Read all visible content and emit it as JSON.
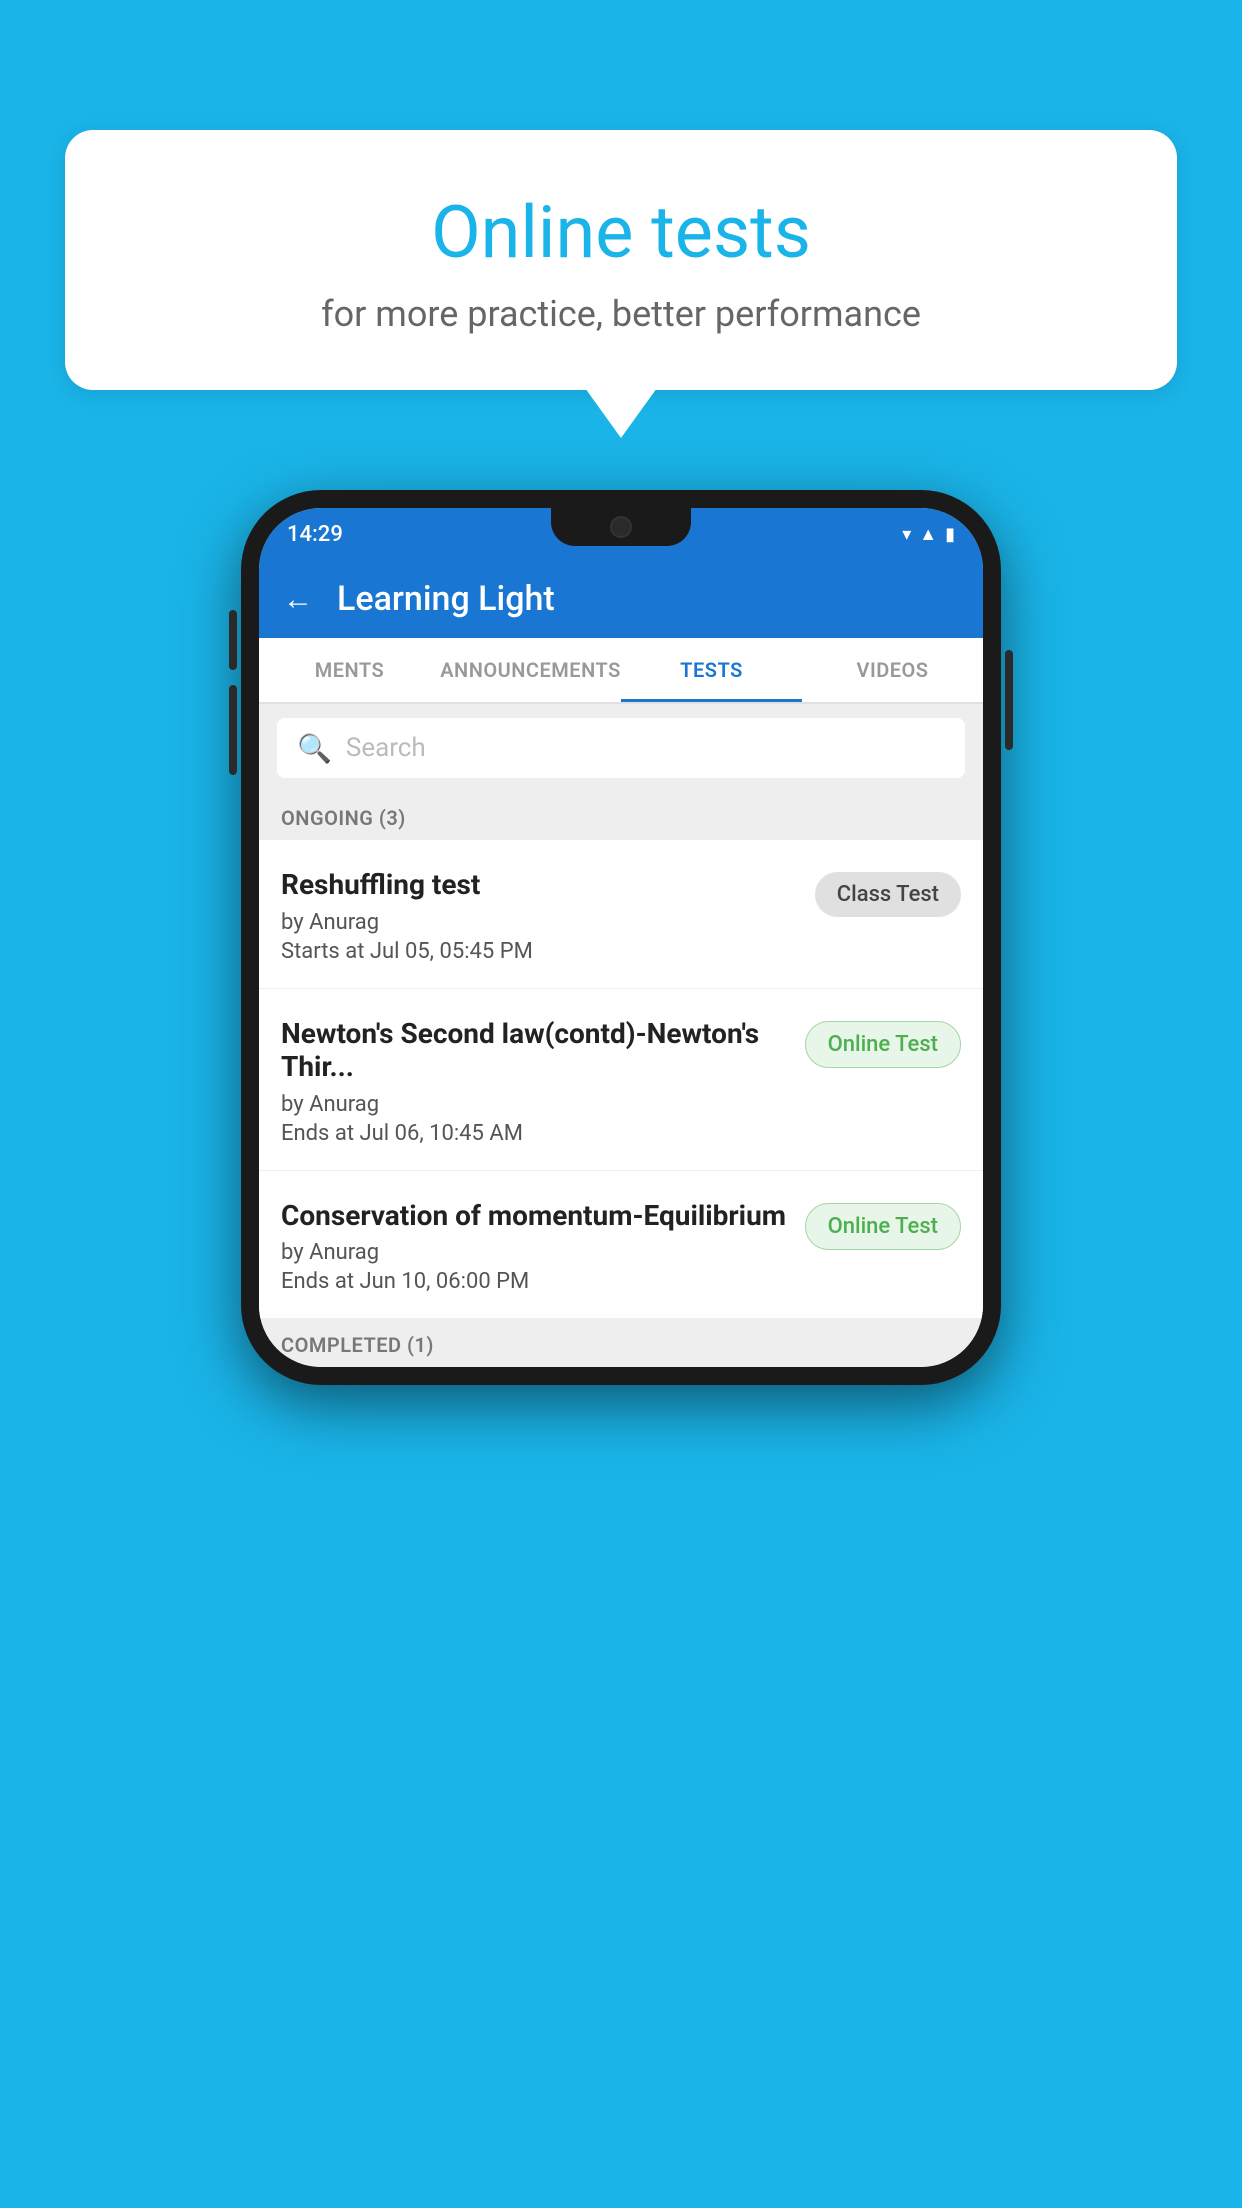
{
  "background": {
    "color": "#1ab4e8"
  },
  "bubble": {
    "title": "Online tests",
    "subtitle": "for more practice, better performance"
  },
  "phone": {
    "status_bar": {
      "time": "14:29"
    },
    "app_bar": {
      "title": "Learning Light",
      "back_label": "←"
    },
    "tabs": [
      {
        "label": "MENTS",
        "active": false
      },
      {
        "label": "ANNOUNCEMENTS",
        "active": false
      },
      {
        "label": "TESTS",
        "active": true
      },
      {
        "label": "VIDEOS",
        "active": false
      }
    ],
    "search": {
      "placeholder": "Search"
    },
    "ongoing_section": {
      "label": "ONGOING (3)"
    },
    "tests": [
      {
        "name": "Reshuffling test",
        "author": "by Anurag",
        "time_label": "Starts at",
        "time": "Jul 05, 05:45 PM",
        "badge": "Class Test",
        "badge_type": "class"
      },
      {
        "name": "Newton's Second law(contd)-Newton's Thir...",
        "author": "by Anurag",
        "time_label": "Ends at",
        "time": "Jul 06, 10:45 AM",
        "badge": "Online Test",
        "badge_type": "online"
      },
      {
        "name": "Conservation of momentum-Equilibrium",
        "author": "by Anurag",
        "time_label": "Ends at",
        "time": "Jun 10, 06:00 PM",
        "badge": "Online Test",
        "badge_type": "online"
      }
    ],
    "completed_section": {
      "label": "COMPLETED (1)"
    }
  }
}
